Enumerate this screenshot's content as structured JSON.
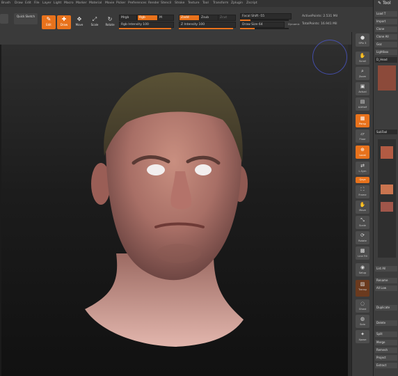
{
  "menu": [
    "Brush",
    "Draw",
    "Edit",
    "File",
    "Layer",
    "Light",
    "Macro",
    "Marker",
    "Material",
    "Movie",
    "Picker",
    "Preferences",
    "Render",
    "Stencil",
    "Stroke",
    "Texture",
    "Tool",
    "Transform",
    "Zplugin",
    "Zscript"
  ],
  "toolbar": {
    "quick_sketch": "Quick Sketch",
    "edit": "Edit",
    "draw": "Draw",
    "move": "Move",
    "scale": "Scale",
    "rotate": "Rotate",
    "mrgb": "Mrgb",
    "rgb": "Rgb",
    "m": "M",
    "zadd": "Zadd",
    "zsub": "Zsub",
    "zcut": "Zcut",
    "rgb_intensity": "Rgb Intensity 100",
    "z_intensity": "Z Intensity 100",
    "focal_shift": "Focal Shift -55",
    "draw_size": "Draw Size 64",
    "dynamic": "Dynamic",
    "active_points": "ActivePoints: 2.531 Mil",
    "total_points": "TotalPoints: 16.941 Mil"
  },
  "shelf": [
    {
      "label": "SPix 3",
      "icon": "sphere-icon"
    },
    {
      "label": "Scroll",
      "icon": "scroll-icon"
    },
    {
      "label": "Zoom",
      "icon": "zoom-icon"
    },
    {
      "label": "Actual",
      "icon": "actual-icon"
    },
    {
      "label": "AAHalf",
      "icon": "aahalf-icon"
    },
    {
      "label": "Persp",
      "icon": "persp-icon"
    },
    {
      "label": "Floor",
      "icon": "floor-icon"
    },
    {
      "label": "Local",
      "icon": "local-icon"
    },
    {
      "label": "L.Sym",
      "icon": "lsym-icon"
    },
    {
      "label": "Qxyz",
      "icon": "xyz-icon"
    },
    {
      "label": "Frame",
      "icon": "frame-icon"
    },
    {
      "label": "Move",
      "icon": "move-icon"
    },
    {
      "label": "Scale",
      "icon": "scale-icon"
    },
    {
      "label": "Rotate",
      "icon": "rotate-icon"
    },
    {
      "label": "Line Fill",
      "icon": "linefill-icon"
    },
    {
      "label": "Setup",
      "icon": "setup-icon"
    },
    {
      "label": "Transp",
      "icon": "transp-icon"
    },
    {
      "label": "Ghost",
      "icon": "ghost-icon"
    },
    {
      "label": "Solo",
      "icon": "solo-icon"
    },
    {
      "label": "Xpose",
      "icon": "xpose-icon"
    }
  ],
  "tool_panel": {
    "title": "Tool",
    "rows": [
      "Load T",
      "Import",
      "Clone",
      "Clone All",
      "Goz",
      "Lightbox",
      "D_Head",
      "SubTool",
      "List All",
      "Rename",
      "All Low",
      "Duplicate",
      "Delete",
      "Split",
      "Merge",
      "Remesh",
      "Project",
      "Extract"
    ]
  },
  "colors": {
    "accent": "#e8721c",
    "viewring": "#4a56c8"
  }
}
